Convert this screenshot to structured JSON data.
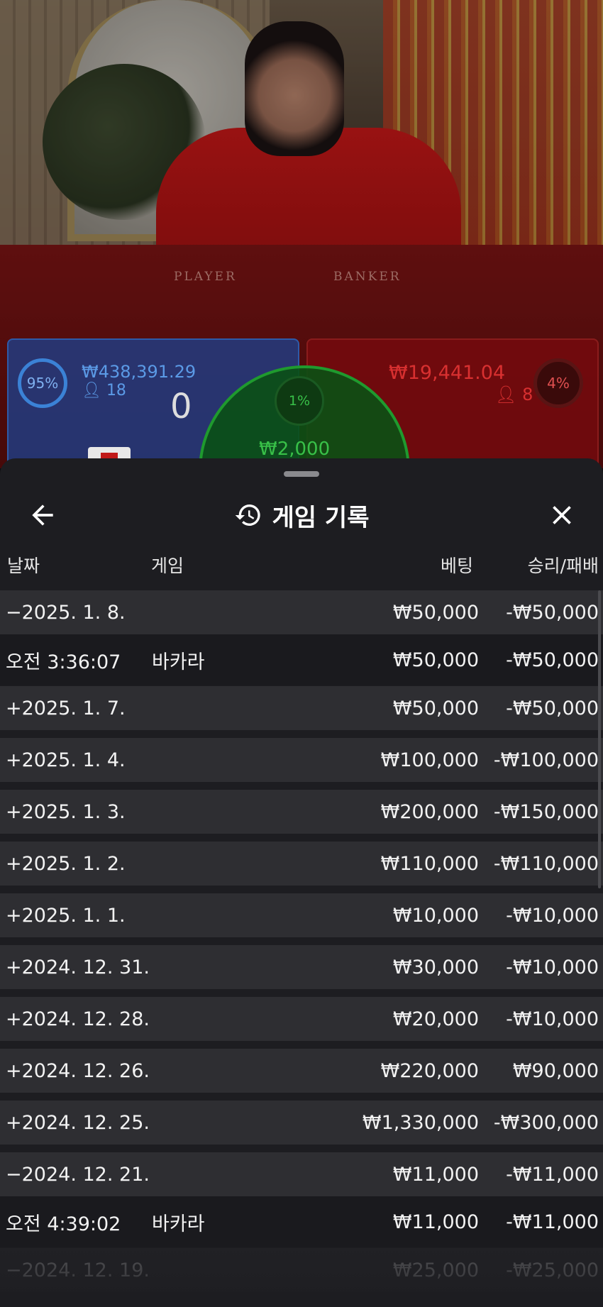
{
  "video": {
    "table_labels": {
      "player": "PLAYER",
      "banker": "BANKER"
    },
    "player": {
      "percent": "95%",
      "amount": "₩438,391.29",
      "count": "18",
      "score": "0"
    },
    "banker": {
      "percent": "4%",
      "amount": "₩19,441.04",
      "count": "8"
    },
    "tie": {
      "percent": "1%",
      "amount": "₩2,000"
    },
    "colors": {
      "player": "#3b82d6",
      "banker": "#d83030",
      "tie": "#38c048"
    }
  },
  "sheet": {
    "title": "게임 기록",
    "back_icon": "arrow-left-icon",
    "title_icon": "history-icon",
    "close_icon": "close-icon",
    "columns": {
      "date": "날짜",
      "game": "게임",
      "bet": "베팅",
      "win_loss": "승리/패배"
    },
    "rows": [
      {
        "date": "−2025. 1. 8.",
        "game": "",
        "bet": "₩50,000",
        "win_loss": "-₩50,000",
        "kind": "day"
      },
      {
        "date": "오전 3:36:07",
        "game": "바카라",
        "bet": "₩50,000",
        "win_loss": "-₩50,000",
        "kind": "detail"
      },
      {
        "date": "+2025. 1. 7.",
        "game": "",
        "bet": "₩50,000",
        "win_loss": "-₩50,000",
        "kind": "day"
      },
      {
        "date": "+2025. 1. 4.",
        "game": "",
        "bet": "₩100,000",
        "win_loss": "-₩100,000",
        "kind": "day"
      },
      {
        "date": "+2025. 1. 3.",
        "game": "",
        "bet": "₩200,000",
        "win_loss": "-₩150,000",
        "kind": "day"
      },
      {
        "date": "+2025. 1. 2.",
        "game": "",
        "bet": "₩110,000",
        "win_loss": "-₩110,000",
        "kind": "day"
      },
      {
        "date": "+2025. 1. 1.",
        "game": "",
        "bet": "₩10,000",
        "win_loss": "-₩10,000",
        "kind": "day"
      },
      {
        "date": "+2024. 12. 31.",
        "game": "",
        "bet": "₩30,000",
        "win_loss": "-₩10,000",
        "kind": "day"
      },
      {
        "date": "+2024. 12. 28.",
        "game": "",
        "bet": "₩20,000",
        "win_loss": "-₩10,000",
        "kind": "day"
      },
      {
        "date": "+2024. 12. 26.",
        "game": "",
        "bet": "₩220,000",
        "win_loss": "₩90,000",
        "kind": "day"
      },
      {
        "date": "+2024. 12. 25.",
        "game": "",
        "bet": "₩1,330,000",
        "win_loss": "-₩300,000",
        "kind": "day"
      },
      {
        "date": "−2024. 12. 21.",
        "game": "",
        "bet": "₩11,000",
        "win_loss": "-₩11,000",
        "kind": "day"
      },
      {
        "date": "오전 4:39:02",
        "game": "바카라",
        "bet": "₩11,000",
        "win_loss": "-₩11,000",
        "kind": "detail"
      },
      {
        "date": "−2024. 12. 19.",
        "game": "",
        "bet": "₩25,000",
        "win_loss": "-₩25,000",
        "kind": "fade"
      }
    ]
  }
}
